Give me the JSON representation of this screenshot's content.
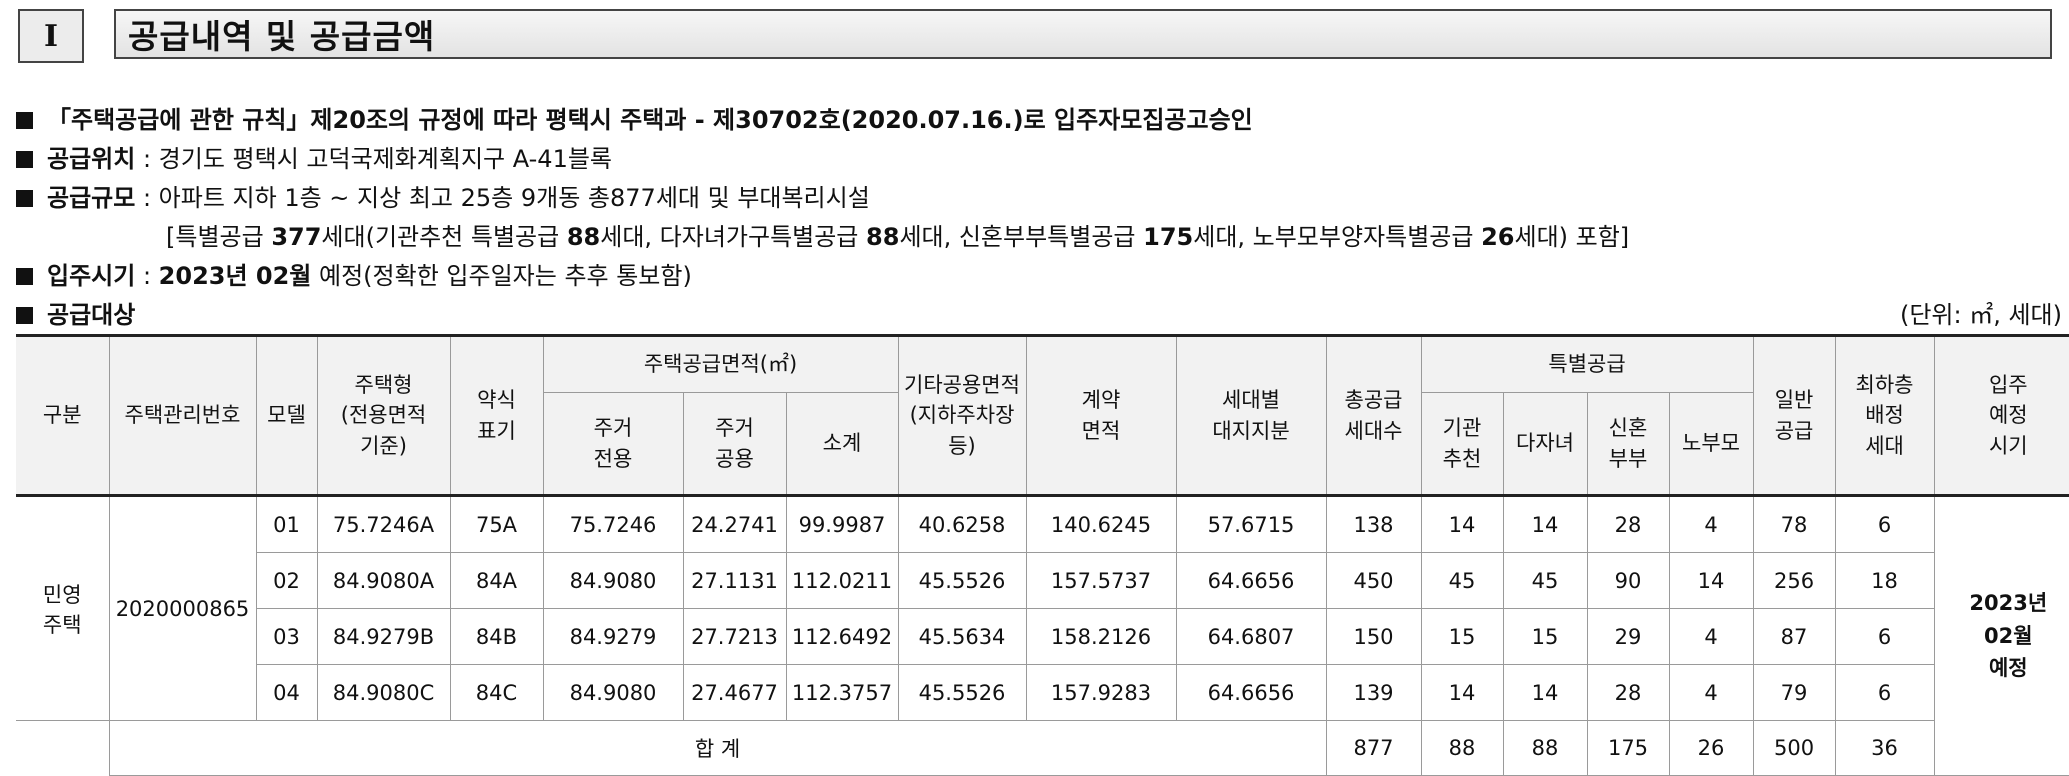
{
  "section": {
    "numeral": "I",
    "title": "공급내역 및 공급금액"
  },
  "info": {
    "approval": "「주택공급에 관한 규칙」제20조의 규정에 따라 평택시 주택과 - 제30702호(2020.07.16.)로 입주자모집공고승인",
    "location_label": "공급위치",
    "location_value": "경기도 평택시 고덕국제화계획지구 A-41블록",
    "scale_label": "공급규모",
    "scale_value": "아파트 지하 1층 ~ 지상 최고 25층 9개동 총877세대 및 부대복리시설",
    "special": {
      "open": "[특별공급 ",
      "total": "377",
      "t1": "세대(기관추천 특별공급 ",
      "inst": "88",
      "t2": "세대, 다자녀가구특별공급 ",
      "multi": "88",
      "t3": "세대, 신혼부부특별공급 ",
      "newlywed": "175",
      "t4": "세대, 노부모부양자특별공급 ",
      "elderly": "26",
      "close": "세대) 포함]"
    },
    "move_in_label": "입주시기",
    "move_in_bold": "2023년 02월",
    "move_in_rest": " 예정(정확한 입주일자는 추후 통보함)",
    "target_label": "공급대상",
    "unit_note": "(단위: ㎡, 세대)"
  },
  "table": {
    "headers": {
      "category": "구분",
      "mgmt_no": "주택관리번호",
      "model": "모델",
      "type_l1": "주택형",
      "type_l2": "(전용면적",
      "type_l3": "기준)",
      "abbr_l1": "약식",
      "abbr_l2": "표기",
      "supply_area": "주택공급면적(㎡)",
      "excl_l1": "주거",
      "excl_l2": "전용",
      "common_l1": "주거",
      "common_l2": "공용",
      "subtotal": "소계",
      "other_l1": "기타공용면적",
      "other_l2": "(지하주차장등)",
      "contract_l1": "계약",
      "contract_l2": "면적",
      "land_l1": "세대별",
      "land_l2": "대지지분",
      "total_l1": "총공급",
      "total_l2": "세대수",
      "special": "특별공급",
      "inst_l1": "기관",
      "inst_l2": "추천",
      "multi": "다자녀",
      "newly_l1": "신혼",
      "newly_l2": "부부",
      "elderly": "노부모",
      "general_l1": "일반",
      "general_l2": "공급",
      "lowest_l1": "최하층",
      "lowest_l2": "배정",
      "lowest_l3": "세대",
      "movein_l1": "입주",
      "movein_l2": "예정",
      "movein_l3": "시기"
    },
    "category_l1": "민영",
    "category_l2": "주택",
    "mgmt_no": "2020000865",
    "movein_l1": "2023년",
    "movein_l2": "02월",
    "movein_l3": "예정",
    "rows": [
      {
        "model": "01",
        "type": "75.7246A",
        "abbr": "75A",
        "excl": "75.7246",
        "common": "24.2741",
        "subtotal": "99.9987",
        "other": "40.6258",
        "contract": "140.6245",
        "land": "57.6715",
        "total": "138",
        "inst": "14",
        "multi": "14",
        "newlywed": "28",
        "elderly": "4",
        "general": "78",
        "lowest": "6"
      },
      {
        "model": "02",
        "type": "84.9080A",
        "abbr": "84A",
        "excl": "84.9080",
        "common": "27.1131",
        "subtotal": "112.0211",
        "other": "45.5526",
        "contract": "157.5737",
        "land": "64.6656",
        "total": "450",
        "inst": "45",
        "multi": "45",
        "newlywed": "90",
        "elderly": "14",
        "general": "256",
        "lowest": "18"
      },
      {
        "model": "03",
        "type": "84.9279B",
        "abbr": "84B",
        "excl": "84.9279",
        "common": "27.7213",
        "subtotal": "112.6492",
        "other": "45.5634",
        "contract": "158.2126",
        "land": "64.6807",
        "total": "150",
        "inst": "15",
        "multi": "15",
        "newlywed": "29",
        "elderly": "4",
        "general": "87",
        "lowest": "6"
      },
      {
        "model": "04",
        "type": "84.9080C",
        "abbr": "84C",
        "excl": "84.9080",
        "common": "27.4677",
        "subtotal": "112.3757",
        "other": "45.5526",
        "contract": "157.9283",
        "land": "64.6656",
        "total": "139",
        "inst": "14",
        "multi": "14",
        "newlywed": "28",
        "elderly": "4",
        "general": "79",
        "lowest": "6"
      }
    ],
    "sum": {
      "label": "합 계",
      "total": "877",
      "inst": "88",
      "multi": "88",
      "newlywed": "175",
      "elderly": "26",
      "general": "500",
      "lowest": "36"
    }
  }
}
